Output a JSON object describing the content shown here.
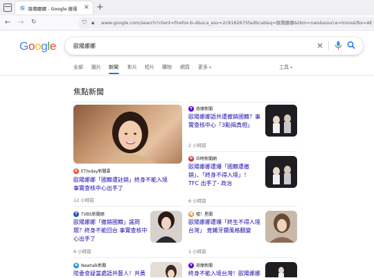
{
  "browser": {
    "tab_title": "歐陽娜娜 - Google 搜尋",
    "url": "www.google.com/search?client=firefox-b-d&sca_esv=2c9182675fadbcab&q=歐陽娜娜&tbm=nws&source=lnms&fbs=AE"
  },
  "google": {
    "logo": "Google",
    "query": "歐陽娜娜",
    "filters": [
      "全部",
      "圖片",
      "新聞",
      "影片",
      "短片",
      "購物",
      "網頁",
      "更多"
    ],
    "active_filter": "新聞",
    "tools": "工具"
  },
  "section_title": "焦點新聞",
  "cards": [
    {
      "source": "ETtoday新聞雲",
      "headline_line1": "歐陽娜娜「國籍遭註銷」終身不能入境",
      "headline_line2": "事實查核中心出手了",
      "age": "12 小時前",
      "icon_color": "#e8552b",
      "icon": "E"
    },
    {
      "source": "奇摩新聞",
      "headline_line1": "歐陽娜娜語共遭撤銷國籍？事",
      "headline_line2": "實查核中心「3點揭真相」",
      "age": "2 小時前",
      "icon_color": "#6001d2",
      "icon": "Y"
    },
    {
      "source": "中時新聞網",
      "headline_line1": "歐陽娜娜遭爆「國籍遭撤",
      "headline_line2": "銷」、「終身不得入境」！",
      "headline_line3": "TFC 出手了- 政治",
      "age": "6 小時前",
      "icon_color": "#d9232d",
      "icon": "中"
    },
    {
      "source": "TVBS新聞網",
      "headline_line1": "歐陽娜娜「撤銷國籍」謠問",
      "headline_line2": "題？終身不能回台 事實查核中",
      "headline_line3": "心出手了",
      "age": "6 小時前",
      "icon_color": "#1d55b8",
      "icon": "T"
    },
    {
      "source": "噓！星聞",
      "headline_line1": "歐陽娜娜遭爆「終生不得入境",
      "headline_line2": "台灣」 竟鐵牙鑽風格翻變",
      "age": "1 小時前",
      "icon_color": "#f28a1e",
      "icon": "噓"
    },
    {
      "source": "Newtalk新聞",
      "headline_line1": "陸委會疑當處語共藝人！共黃",
      "age": "",
      "icon_color": "#1c8fd6",
      "icon": "N"
    },
    {
      "source": "奇摩新聞",
      "headline_line1": "終身不能入境台灣！歐陽娜娜",
      "age": "",
      "icon_color": "#6001d2",
      "icon": "Y"
    }
  ]
}
